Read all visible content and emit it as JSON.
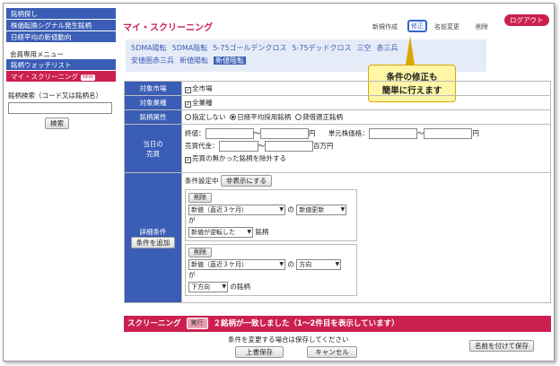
{
  "sidebar": {
    "items": [
      "銘柄探し",
      "株価転換シグナル発生銘柄",
      "日経平均の新値動向"
    ],
    "member_heading": "会員専用メニュー",
    "member_items": [
      "銘柄ウォッチリスト",
      "マイ・スクリーニング"
    ],
    "new_badge": "NEW",
    "search_label": "銘柄検索（コード又は銘柄名）",
    "search_button": "検索"
  },
  "header": {
    "title": "マイ・スクリーニング",
    "new": "新規作成",
    "edit": "修正",
    "rename": "名前変更",
    "delete": "削除",
    "logout": "ログアウト"
  },
  "quick_links": [
    "5DMA陽転",
    "5DMA陰転",
    "5-75ゴールデンクロス",
    "5-75デッドクロス",
    "三空",
    "赤三兵",
    "安値圏赤三兵",
    "新値陽転",
    "新値陰転"
  ],
  "selected_link": "新値陰転",
  "callout": {
    "line1": "条件の修正も",
    "line2": "簡単に行えます"
  },
  "form": {
    "market_label": "対象市場",
    "market_value": "全市場",
    "industry_label": "対象業種",
    "industry_value": "全業種",
    "stock_label": "銘柄属性",
    "stock_opt1": "指定しない",
    "stock_opt2": "日経平均採用銘柄",
    "stock_opt3": "貸借適正銘柄",
    "price_label1": "当日の",
    "price_label2": "売買",
    "close": "終値：",
    "yen": "円",
    "volume": "単元株価格：",
    "yen2": "円",
    "turnover": "売買代金：",
    "million": "百万円",
    "exclude": "売買の無かった銘柄を除外する",
    "detail_label": "詳細条件",
    "add_condition": "条件を追加",
    "setting": "条件設定中",
    "hide": "非表示にする",
    "delete": "削除",
    "c1_select1": "新値（直近３ケ月）",
    "c1_no": "の",
    "c1_select2": "新値更新",
    "c1_ga": "が",
    "c1_select3": "新値が逆転した",
    "c1_suffix": "銘柄",
    "c2_select1": "新値（直近３ケ月）",
    "c2_no": "の",
    "c2_select2": "方向",
    "c2_ga": "が",
    "c2_select3": "下方向",
    "c2_suffix": "の銘柄"
  },
  "status": {
    "label": "スクリーニング",
    "exec": "実行",
    "result": "２銘柄が一致しました（1〜2件目を表示しています）"
  },
  "footer": {
    "note": "条件を変更する場合は保存してください",
    "overwrite": "上書保存",
    "cancel": "キャンセル",
    "save_as": "名前を付けて保存"
  }
}
